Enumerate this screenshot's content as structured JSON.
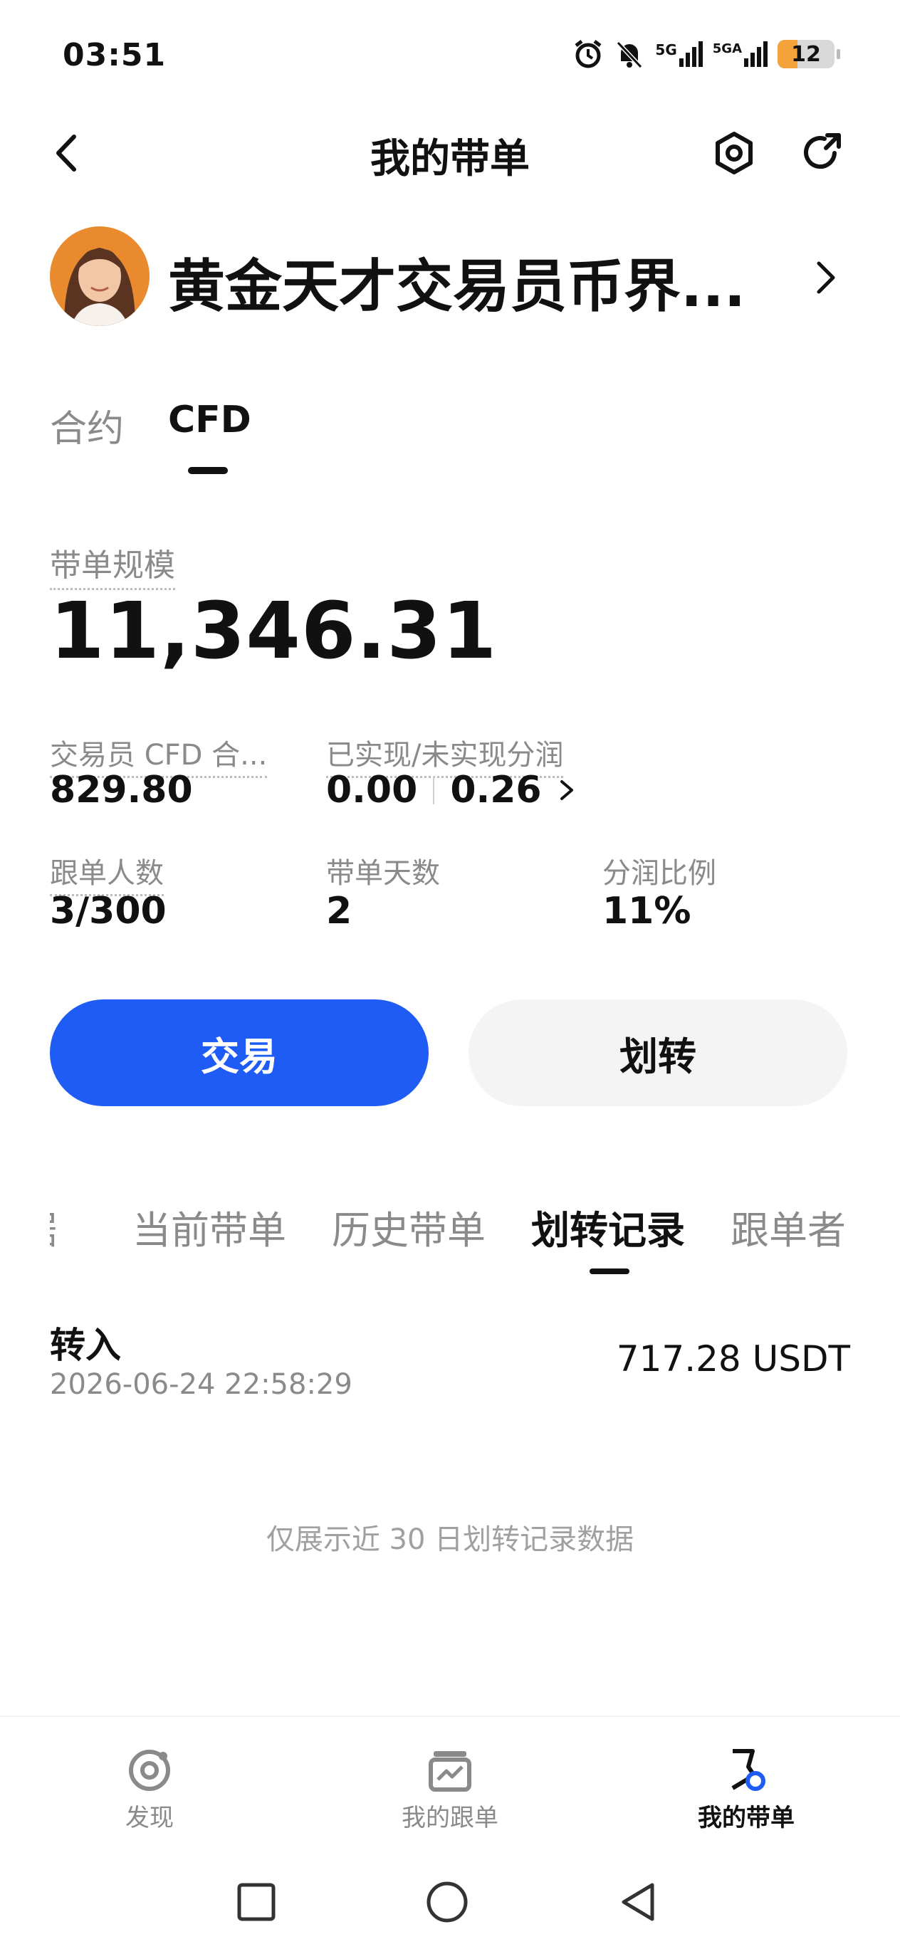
{
  "status_bar": {
    "time": "03:51",
    "network_1": "5G",
    "network_2": "5GA",
    "battery": "12"
  },
  "header": {
    "title": "我的带单",
    "icons": [
      "back-icon",
      "settings-icon",
      "share-icon"
    ]
  },
  "profile": {
    "name": "黄金天才交易员币界..."
  },
  "top_tabs": [
    {
      "label": "合约",
      "active": false
    },
    {
      "label": "CFD",
      "active": true
    }
  ],
  "summary": {
    "scale_label": "带单规模",
    "scale_value": "11,346.31",
    "trader_cfd_label": "交易员 CFD 合...",
    "trader_cfd_value": "829.80",
    "profit_label": "已实现/未实现分润",
    "realized_value": "0.00",
    "unrealized_value": "0.26",
    "followers_label": "跟单人数",
    "followers_value": "3/300",
    "days_label": "带单天数",
    "days_value": "2",
    "ratio_label": "分润比例",
    "ratio_value": "11%"
  },
  "actions": {
    "trade_label": "交易",
    "transfer_label": "划转"
  },
  "sub_tabs": [
    {
      "label": "据",
      "active": false
    },
    {
      "label": "当前带单",
      "active": false
    },
    {
      "label": "历史带单",
      "active": false
    },
    {
      "label": "划转记录",
      "active": true
    },
    {
      "label": "跟单者",
      "active": false
    }
  ],
  "records": [
    {
      "type": "转入",
      "datetime": "2026-06-24 22:58:29",
      "amount": "717.28 USDT"
    }
  ],
  "notice": "仅展示近 30 日划转记录数据",
  "bottom_nav": [
    {
      "label": "发现",
      "icon": "discover-icon",
      "active": false
    },
    {
      "label": "我的跟单",
      "icon": "copy-trade-icon",
      "active": false
    },
    {
      "label": "我的带单",
      "icon": "lead-trade-icon",
      "active": true
    }
  ],
  "colors": {
    "accent": "#1f5cf6",
    "muted": "#8a8a8a",
    "secondary_button": "#f4f4f4"
  }
}
